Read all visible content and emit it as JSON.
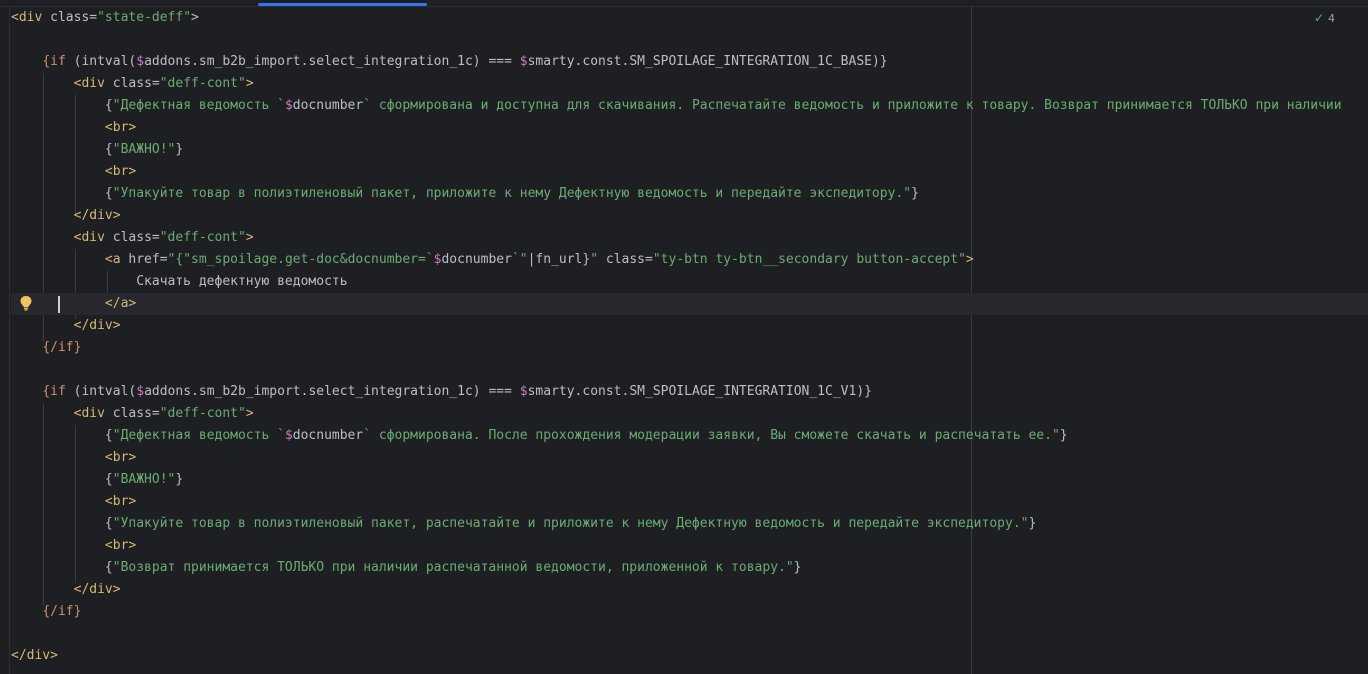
{
  "inspection": {
    "count": "4",
    "icon": "check-icon"
  },
  "lines": [
    [
      [
        "tag",
        "<div"
      ],
      [
        "attr",
        " class="
      ],
      [
        "str",
        "\"state-deff\""
      ],
      [
        "plain",
        ">"
      ]
    ],
    [],
    [
      [
        "plain",
        "    "
      ],
      [
        "kw",
        "{if"
      ],
      [
        "plain",
        " (intval("
      ],
      [
        "var",
        "$"
      ],
      [
        "plain",
        "addons.sm_b2b_import.select_integration_1c) === "
      ],
      [
        "var",
        "$"
      ],
      [
        "plain",
        "smarty.const.SM_SPOILAGE_INTEGRATION_1C_BASE)}"
      ]
    ],
    [
      [
        "plain",
        "        "
      ],
      [
        "tag",
        "<div"
      ],
      [
        "attr",
        " class="
      ],
      [
        "str",
        "\"deff-cont\""
      ],
      [
        "tag",
        ">"
      ]
    ],
    [
      [
        "plain",
        "            {"
      ],
      [
        "str",
        "\"Дефектная ведомость `"
      ],
      [
        "var",
        "$"
      ],
      [
        "plain",
        "docnumber"
      ],
      [
        "str",
        "` сформирована и доступна для скачивания. Распечатайте ведомость и приложите к товару. Возврат принимается ТОЛЬКО при наличии"
      ]
    ],
    [
      [
        "plain",
        "            "
      ],
      [
        "tag",
        "<br>"
      ]
    ],
    [
      [
        "plain",
        "            {"
      ],
      [
        "str",
        "\"ВАЖНО!\""
      ],
      [
        "plain",
        "}"
      ]
    ],
    [
      [
        "plain",
        "            "
      ],
      [
        "tag",
        "<br>"
      ]
    ],
    [
      [
        "plain",
        "            {"
      ],
      [
        "str",
        "\"Упакуйте товар в полиэтиленовый пакет, приложите к нему Дефектную ведомость и передайте экспедитору.\""
      ],
      [
        "plain",
        "}"
      ]
    ],
    [
      [
        "plain",
        "        "
      ],
      [
        "tag",
        "</div>"
      ]
    ],
    [
      [
        "plain",
        "        "
      ],
      [
        "tag",
        "<div"
      ],
      [
        "attr",
        " class="
      ],
      [
        "str",
        "\"deff-cont\""
      ],
      [
        "tag",
        ">"
      ]
    ],
    [
      [
        "plain",
        "            "
      ],
      [
        "tag",
        "<a"
      ],
      [
        "attr",
        " href="
      ],
      [
        "str",
        "\"{"
      ],
      [
        "str",
        "\"sm_spoilage.get-doc&docnumber=`"
      ],
      [
        "var",
        "$"
      ],
      [
        "plain",
        "docnumber"
      ],
      [
        "str",
        "`\""
      ],
      [
        "pipe",
        "|fn_url}"
      ],
      [
        "str",
        "\""
      ],
      [
        "attr",
        " class="
      ],
      [
        "str",
        "\"ty-btn ty-btn__secondary button-accept\""
      ],
      [
        "tag",
        ">"
      ]
    ],
    [
      [
        "plain",
        "                Скачать дефектную ведомость"
      ]
    ],
    [
      [
        "plain",
        "            "
      ],
      [
        "tag",
        "</a>"
      ]
    ],
    [
      [
        "plain",
        "        "
      ],
      [
        "tag",
        "</div>"
      ]
    ],
    [
      [
        "plain",
        "    "
      ],
      [
        "kw",
        "{/if}"
      ]
    ],
    [],
    [
      [
        "plain",
        "    "
      ],
      [
        "kw",
        "{if"
      ],
      [
        "plain",
        " (intval("
      ],
      [
        "var",
        "$"
      ],
      [
        "plain",
        "addons.sm_b2b_import.select_integration_1c) === "
      ],
      [
        "var",
        "$"
      ],
      [
        "plain",
        "smarty.const.SM_SPOILAGE_INTEGRATION_1C_V1)}"
      ]
    ],
    [
      [
        "plain",
        "        "
      ],
      [
        "tag",
        "<div"
      ],
      [
        "attr",
        " class="
      ],
      [
        "str",
        "\"deff-cont\""
      ],
      [
        "tag",
        ">"
      ]
    ],
    [
      [
        "plain",
        "            {"
      ],
      [
        "str",
        "\"Дефектная ведомость `"
      ],
      [
        "var",
        "$"
      ],
      [
        "plain",
        "docnumber"
      ],
      [
        "str",
        "` сформирована. После прохождения модерации заявки, Вы сможете скачать и распечатать ее.\""
      ],
      [
        "plain",
        "}"
      ]
    ],
    [
      [
        "plain",
        "            "
      ],
      [
        "tag",
        "<br>"
      ]
    ],
    [
      [
        "plain",
        "            {"
      ],
      [
        "str",
        "\"ВАЖНО!\""
      ],
      [
        "plain",
        "}"
      ]
    ],
    [
      [
        "plain",
        "            "
      ],
      [
        "tag",
        "<br>"
      ]
    ],
    [
      [
        "plain",
        "            {"
      ],
      [
        "str",
        "\"Упакуйте товар в полиэтиленовый пакет, распечатайте и приложите к нему Дефектную ведомость и передайте экспедитору.\""
      ],
      [
        "plain",
        "}"
      ]
    ],
    [
      [
        "plain",
        "            "
      ],
      [
        "tag",
        "<br>"
      ]
    ],
    [
      [
        "plain",
        "            {"
      ],
      [
        "str",
        "\"Возврат принимается ТОЛЬКО при наличии распечатанной ведомости, приложенной к товару.\""
      ],
      [
        "plain",
        "}"
      ]
    ],
    [
      [
        "plain",
        "        "
      ],
      [
        "tag",
        "</div>"
      ]
    ],
    [
      [
        "plain",
        "    "
      ],
      [
        "kw",
        "{/if}"
      ]
    ],
    [],
    [
      [
        "tag",
        "</div>"
      ]
    ]
  ]
}
